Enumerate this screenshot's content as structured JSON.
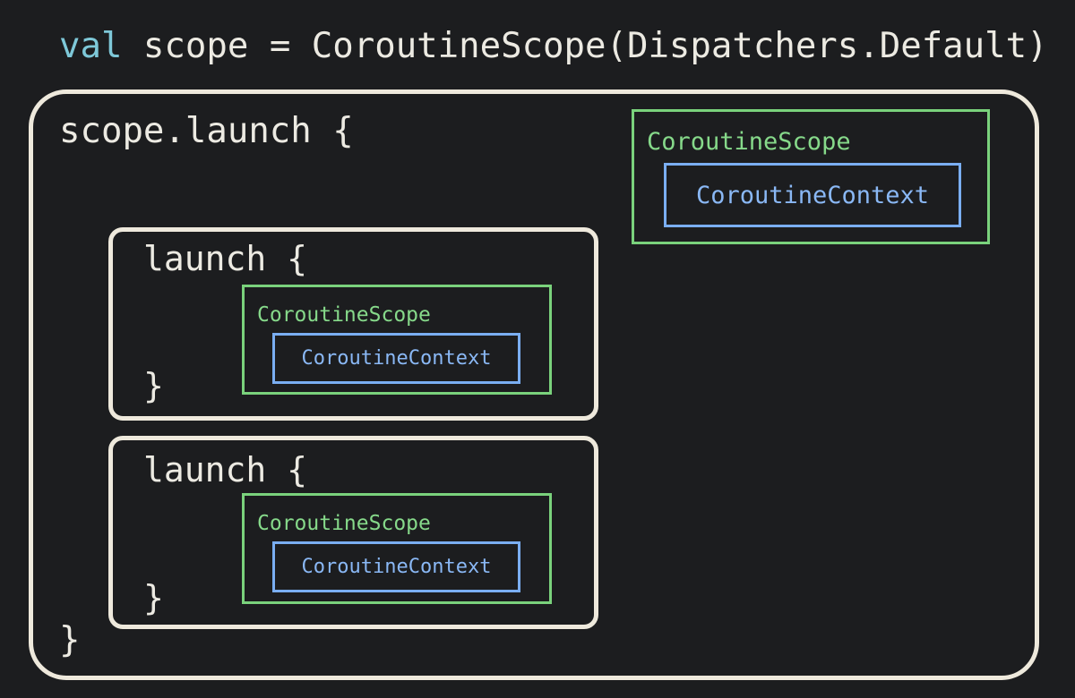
{
  "header": {
    "keyword": "val",
    "rest": " scope = CoroutineScope(Dispatchers.Default)"
  },
  "outer": {
    "open": "scope.launch {",
    "close": "}",
    "scope_label": "CoroutineScope",
    "context_label": "CoroutineContext"
  },
  "children": [
    {
      "open": "launch {",
      "close": "}",
      "scope_label": "CoroutineScope",
      "context_label": "CoroutineContext"
    },
    {
      "open": "launch {",
      "close": "}",
      "scope_label": "CoroutineScope",
      "context_label": "CoroutineContext"
    }
  ],
  "colors": {
    "background": "#1c1d1f",
    "code_text": "#eceae2",
    "keyword": "#7ec8d8",
    "scope_border": "#7ad27c",
    "context_border": "#7aaef2"
  }
}
